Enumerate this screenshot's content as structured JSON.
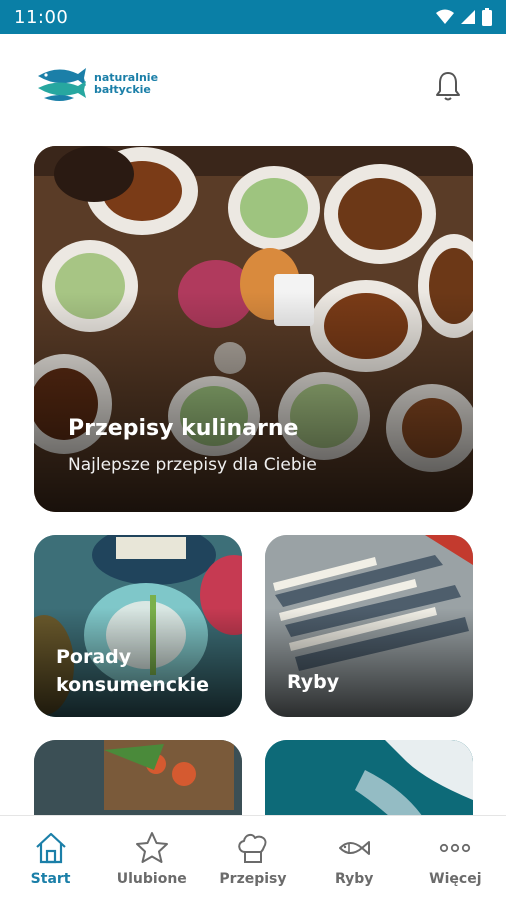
{
  "status_bar": {
    "time": "11:00"
  },
  "header": {
    "logo_line1": "naturalnie",
    "logo_line2": "bałtyckie"
  },
  "hero_card": {
    "title": "Przepisy kulinarne",
    "subtitle": "Najlepsze przepisy dla Ciebie"
  },
  "grid_cards": [
    {
      "title_line1": "Porady",
      "title_line2": "konsumenckie"
    },
    {
      "title_line1": "Ryby",
      "title_line2": ""
    }
  ],
  "nav": {
    "items": [
      {
        "label": "Start",
        "icon": "home-icon"
      },
      {
        "label": "Ulubione",
        "icon": "star-icon"
      },
      {
        "label": "Przepisy",
        "icon": "chef-hat-icon"
      },
      {
        "label": "Ryby",
        "icon": "fish-icon"
      },
      {
        "label": "Więcej",
        "icon": "more-icon"
      }
    ]
  },
  "colors": {
    "brand": "#1b7fa8",
    "status_bar": "#0a7fa6"
  }
}
